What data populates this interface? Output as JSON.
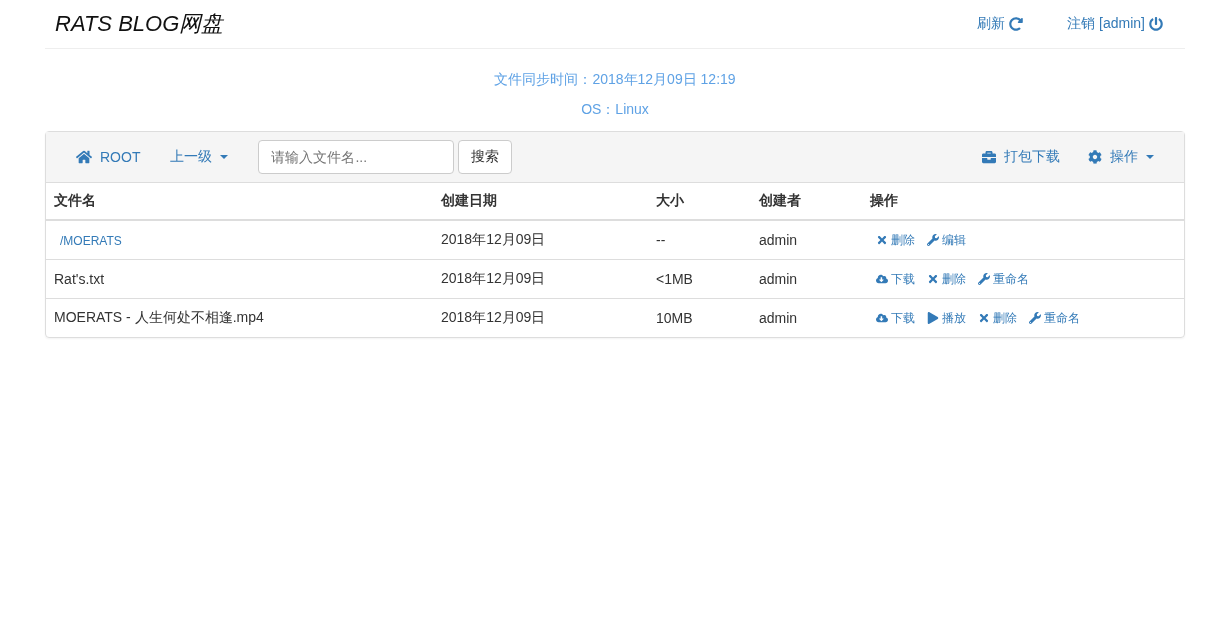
{
  "brand": "RATS BLOG网盘",
  "nav": [
    {
      "label": "刷新",
      "kind": "refresh"
    },
    {
      "label": "注销 [admin]",
      "kind": "logout"
    }
  ],
  "info": [
    "文件同步时间：2018年12月09日 12:19",
    "OS：Linux"
  ],
  "toolbar": {
    "root": "ROOT",
    "up": "上一级",
    "search": {
      "placeholder": "请输入文件名..."
    },
    "search_button": "搜索",
    "pack": "打包下载",
    "ops": "操作"
  },
  "table": {
    "columns": [
      "文件名",
      "创建日期",
      "大小",
      "创建者",
      "操作"
    ],
    "rows": [
      {
        "kind": "folder",
        "name": "/MOERATS",
        "date": "2018年12月09日",
        "size": "--",
        "creator": "admin",
        "actions": [
          {
            "kind": "delete",
            "label": "删除"
          },
          {
            "kind": "edit",
            "label": "编辑"
          }
        ]
      },
      {
        "kind": "file",
        "name": "Rat's.txt",
        "date": "2018年12月09日",
        "size": "<1MB",
        "creator": "admin",
        "actions": [
          {
            "kind": "download",
            "label": "下载"
          },
          {
            "kind": "delete",
            "label": "删除"
          },
          {
            "kind": "edit",
            "label": "重命名"
          }
        ]
      },
      {
        "kind": "file",
        "name": "MOERATS - 人生何处不相逢.mp4",
        "date": "2018年12月09日",
        "size": "10MB",
        "creator": "admin",
        "actions": [
          {
            "kind": "download",
            "label": "下载"
          },
          {
            "kind": "play",
            "label": "播放"
          },
          {
            "kind": "delete",
            "label": "删除"
          },
          {
            "kind": "edit",
            "label": "重命名"
          }
        ]
      }
    ]
  }
}
